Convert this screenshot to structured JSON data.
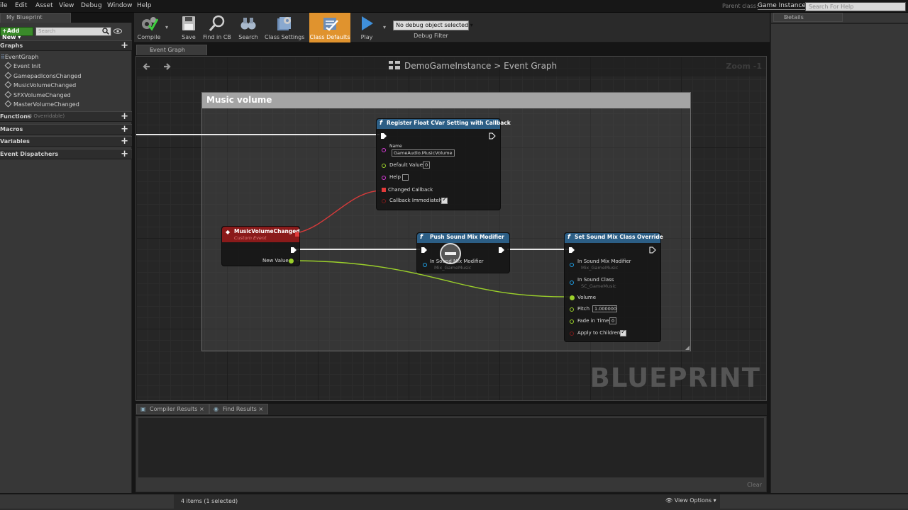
{
  "menu": [
    "ile",
    "Edit",
    "Asset",
    "View",
    "Debug",
    "Window",
    "Help"
  ],
  "parent_class": {
    "label": "Parent class:",
    "value": "Game Instance"
  },
  "help_search_placeholder": "Search For Help",
  "left_panel": {
    "tab": "My Blueprint",
    "add_new": "Add New",
    "search_placeholder": "Search",
    "graphs_header": "Graphs",
    "event_graph": "EventGraph",
    "events": [
      "Event Init",
      "GamepadIconsChanged",
      "MusicVolumeChanged",
      "SFXVolumeChanged",
      "MasterVolumeChanged"
    ],
    "functions_header": "Functions",
    "functions_sub": "(3 Overridable)",
    "macros_header": "Macros",
    "variables_header": "Variables",
    "dispatchers_header": "Event Dispatchers"
  },
  "toolbar": {
    "compile": "Compile",
    "save": "Save",
    "find_in_cb": "Find in CB",
    "search": "Search",
    "class_settings": "Class Settings",
    "class_defaults": "Class Defaults",
    "play": "Play",
    "debug_select": "No debug object selected",
    "debug_filter": "Debug Filter"
  },
  "details_tab": "Details",
  "graph_tab": "Event Graph",
  "breadcrumb": {
    "root": "DemoGameInstance",
    "sep": ">",
    "current": "Event Graph"
  },
  "zoom": "Zoom -1",
  "watermark": "BLUEPRINT",
  "comment_title": "Music volume",
  "nodes": {
    "register": {
      "title": "Register Float CVar Setting with Callback",
      "name_label": "Name",
      "name_value": "GameAudio.MusicVolume",
      "default_label": "Default Value",
      "default_value": "0",
      "help_label": "Help",
      "changed_callback": "Changed Callback",
      "callback_immediately": "Callback Immediately"
    },
    "event": {
      "title": "MusicVolumeChanged",
      "subtitle": "Custom Event",
      "new_value": "New Value"
    },
    "push": {
      "title": "Push Sound Mix Modifier",
      "in_mod_label": "In Sound Mix Modifier",
      "in_mod_value": "Mix_GameMusic"
    },
    "set": {
      "title": "Set Sound Mix Class Override",
      "in_mod_label": "In Sound Mix Modifier",
      "in_mod_value": "Mix_GameMusic",
      "in_class_label": "In Sound Class",
      "in_class_value": "SC_GameMusic",
      "volume_label": "Volume",
      "pitch_label": "Pitch",
      "pitch_value": "1.000000",
      "fade_label": "Fade in Time",
      "fade_value": "0",
      "apply_label": "Apply to Children"
    }
  },
  "bottom": {
    "tab1": "Compiler Results",
    "tab2": "Find Results",
    "clear": "Clear"
  },
  "status": {
    "items": "4 items (1 selected)",
    "view_options": "View Options"
  },
  "colors": {
    "accent_orange": "#e0932e",
    "function_node": "#2c5e85",
    "event_node": "#8a1a1a",
    "float_pin": "#9bd02a",
    "delegate_pin": "#e23a3a",
    "object_pin": "#1e9be0"
  }
}
